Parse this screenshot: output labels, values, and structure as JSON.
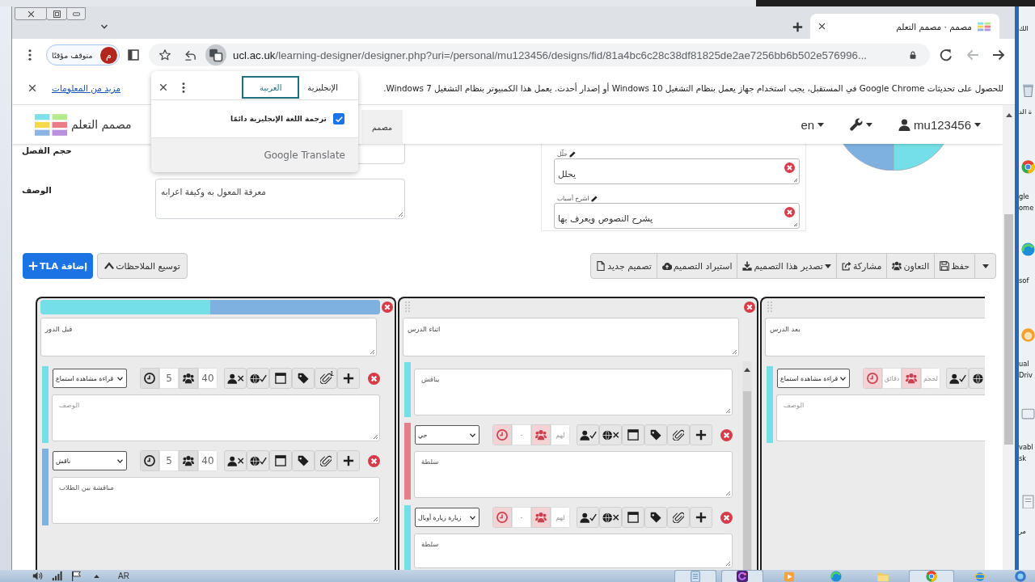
{
  "browser": {
    "tab": {
      "title": "مصمم · مصمم التعلم"
    },
    "profile": {
      "initial": "م",
      "status": "متوقف مؤقتًا"
    },
    "address": {
      "host": "ucl.ac.uk",
      "path": "/learning-designer/designer.php?uri=/personal/mu123456/designs/fid/81a4bc6c28c38df81825de2ae7256bb6b502e576996..."
    },
    "back_disabled": false,
    "forward_disabled": true
  },
  "infobar": {
    "message": "للحصول على تحديثات Google Chrome في المستقبل، يجب استخدام جهاز يعمل بنظام التشغيل Windows 10 أو إصدار أحدث. يعمل هذا الكمبيوتر بنظام التشغيل Windows 7.",
    "link": "مزيد من المعلومات"
  },
  "translate_popup": {
    "languages": [
      {
        "label": "الإنجليزية",
        "selected": false
      },
      {
        "label": "العربية",
        "selected": true
      }
    ],
    "always_translate": {
      "label": "ترجمة اللغة الإنجليزية دائمًا",
      "checked": true
    },
    "footer": "Google Translate"
  },
  "navbar": {
    "logo": "مصمم التعلم",
    "tabs": [
      {
        "label": "مصمم",
        "selected": true
      }
    ],
    "language": "en",
    "user": "mu123456"
  },
  "design": {
    "fields": [
      {
        "kind": "input",
        "label": "حجم الفصل"
      },
      {
        "kind": "textarea",
        "label": "الوصف",
        "value": "معرفة المعول به وكيفة اعرابه"
      }
    ],
    "outcomes": [
      {
        "verb": "حلّل",
        "text": "يحلل"
      },
      {
        "verb": "اشرح أسباب",
        "text": "يشرح النصوص ويعرف بها"
      }
    ]
  },
  "actions": [
    {
      "kind": "more"
    },
    {
      "kind": "save",
      "label": "حفظ"
    },
    {
      "kind": "collaborate",
      "label": "التعاون"
    },
    {
      "kind": "share",
      "label": "مشاركة"
    },
    {
      "kind": "export",
      "label": "تصدير هذا التصميم"
    },
    {
      "kind": "import",
      "label": "استيراد التصميم"
    },
    {
      "kind": "new",
      "label": "تصميم جديد"
    },
    {
      "kind": "notes",
      "label": "توسيع الملاحظات"
    },
    {
      "kind": "add",
      "label": "إضافة TLA"
    }
  ],
  "sessions": [
    {
      "title": "بعد الدرس",
      "activities": [
        {
          "type": "قراءة مشاهدة استماع",
          "color": "#74dfe6",
          "duration": {
            "placeholder": "دقائق"
          },
          "learners": {
            "placeholder": "لحجم"
          },
          "teacher_present": true,
          "description": {
            "placeholder": "الوصف"
          }
        }
      ]
    },
    {
      "title": "اثناء الدرس",
      "activities": [
        {
          "color": "#74dfe6",
          "description": {
            "value": "يناقش"
          }
        },
        {
          "type": "حي",
          "color": "#e57f8a",
          "duration": {
            "placeholder": "-"
          },
          "learners": {
            "placeholder": "لهم"
          },
          "teacher_present": true,
          "online": false,
          "description": {
            "value": "سلطة"
          }
        },
        {
          "type": "زيارة زيارة أوبال",
          "color": "#74dfe6",
          "duration": {
            "placeholder": "-"
          },
          "learners": {
            "placeholder": "لهم"
          },
          "teacher_present": true,
          "online": false,
          "description": {
            "value": "سلطة"
          }
        }
      ]
    },
    {
      "title": "قبل الدور",
      "activities": [
        {
          "type": "قراءة مشاهدة استماع",
          "color": "#74dfe6",
          "duration": {
            "value": "5"
          },
          "learners": {
            "value": "40"
          },
          "teacher_present": false,
          "online": true,
          "attachments": "1",
          "description": {
            "placeholder": "الوصف"
          }
        },
        {
          "type": "ناقش",
          "color": "#7eb0e0",
          "duration": {
            "value": "5"
          },
          "learners": {
            "value": "40"
          },
          "teacher_present": false,
          "online": true,
          "description": {
            "value": "مناقشة بين الطلاب"
          }
        }
      ]
    }
  ],
  "taskbar": {
    "language": "AR"
  },
  "desktop_icons": [
    {
      "label": "الك"
    },
    {
      "label": "ة الد"
    },
    {
      "label": "gle ome"
    },
    {
      "label": "sof"
    },
    {
      "label": "ual Driv"
    },
    {
      "label": "vabl sk"
    },
    {
      "label": "مر"
    }
  ]
}
